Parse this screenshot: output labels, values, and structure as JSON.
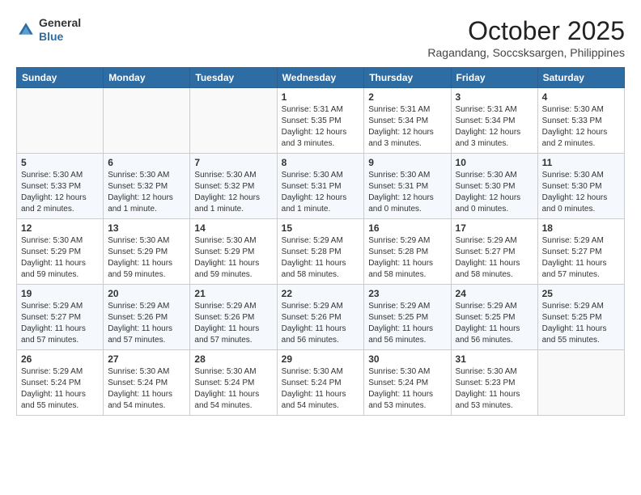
{
  "header": {
    "logo_general": "General",
    "logo_blue": "Blue",
    "month": "October 2025",
    "location": "Ragandang, Soccsksargen, Philippines"
  },
  "days_of_week": [
    "Sunday",
    "Monday",
    "Tuesday",
    "Wednesday",
    "Thursday",
    "Friday",
    "Saturday"
  ],
  "weeks": [
    [
      {
        "day": "",
        "content": ""
      },
      {
        "day": "",
        "content": ""
      },
      {
        "day": "",
        "content": ""
      },
      {
        "day": "1",
        "content": "Sunrise: 5:31 AM\nSunset: 5:35 PM\nDaylight: 12 hours and 3 minutes."
      },
      {
        "day": "2",
        "content": "Sunrise: 5:31 AM\nSunset: 5:34 PM\nDaylight: 12 hours and 3 minutes."
      },
      {
        "day": "3",
        "content": "Sunrise: 5:31 AM\nSunset: 5:34 PM\nDaylight: 12 hours and 3 minutes."
      },
      {
        "day": "4",
        "content": "Sunrise: 5:30 AM\nSunset: 5:33 PM\nDaylight: 12 hours and 2 minutes."
      }
    ],
    [
      {
        "day": "5",
        "content": "Sunrise: 5:30 AM\nSunset: 5:33 PM\nDaylight: 12 hours and 2 minutes."
      },
      {
        "day": "6",
        "content": "Sunrise: 5:30 AM\nSunset: 5:32 PM\nDaylight: 12 hours and 1 minute."
      },
      {
        "day": "7",
        "content": "Sunrise: 5:30 AM\nSunset: 5:32 PM\nDaylight: 12 hours and 1 minute."
      },
      {
        "day": "8",
        "content": "Sunrise: 5:30 AM\nSunset: 5:31 PM\nDaylight: 12 hours and 1 minute."
      },
      {
        "day": "9",
        "content": "Sunrise: 5:30 AM\nSunset: 5:31 PM\nDaylight: 12 hours and 0 minutes."
      },
      {
        "day": "10",
        "content": "Sunrise: 5:30 AM\nSunset: 5:30 PM\nDaylight: 12 hours and 0 minutes."
      },
      {
        "day": "11",
        "content": "Sunrise: 5:30 AM\nSunset: 5:30 PM\nDaylight: 12 hours and 0 minutes."
      }
    ],
    [
      {
        "day": "12",
        "content": "Sunrise: 5:30 AM\nSunset: 5:29 PM\nDaylight: 11 hours and 59 minutes."
      },
      {
        "day": "13",
        "content": "Sunrise: 5:30 AM\nSunset: 5:29 PM\nDaylight: 11 hours and 59 minutes."
      },
      {
        "day": "14",
        "content": "Sunrise: 5:30 AM\nSunset: 5:29 PM\nDaylight: 11 hours and 59 minutes."
      },
      {
        "day": "15",
        "content": "Sunrise: 5:29 AM\nSunset: 5:28 PM\nDaylight: 11 hours and 58 minutes."
      },
      {
        "day": "16",
        "content": "Sunrise: 5:29 AM\nSunset: 5:28 PM\nDaylight: 11 hours and 58 minutes."
      },
      {
        "day": "17",
        "content": "Sunrise: 5:29 AM\nSunset: 5:27 PM\nDaylight: 11 hours and 58 minutes."
      },
      {
        "day": "18",
        "content": "Sunrise: 5:29 AM\nSunset: 5:27 PM\nDaylight: 11 hours and 57 minutes."
      }
    ],
    [
      {
        "day": "19",
        "content": "Sunrise: 5:29 AM\nSunset: 5:27 PM\nDaylight: 11 hours and 57 minutes."
      },
      {
        "day": "20",
        "content": "Sunrise: 5:29 AM\nSunset: 5:26 PM\nDaylight: 11 hours and 57 minutes."
      },
      {
        "day": "21",
        "content": "Sunrise: 5:29 AM\nSunset: 5:26 PM\nDaylight: 11 hours and 57 minutes."
      },
      {
        "day": "22",
        "content": "Sunrise: 5:29 AM\nSunset: 5:26 PM\nDaylight: 11 hours and 56 minutes."
      },
      {
        "day": "23",
        "content": "Sunrise: 5:29 AM\nSunset: 5:25 PM\nDaylight: 11 hours and 56 minutes."
      },
      {
        "day": "24",
        "content": "Sunrise: 5:29 AM\nSunset: 5:25 PM\nDaylight: 11 hours and 56 minutes."
      },
      {
        "day": "25",
        "content": "Sunrise: 5:29 AM\nSunset: 5:25 PM\nDaylight: 11 hours and 55 minutes."
      }
    ],
    [
      {
        "day": "26",
        "content": "Sunrise: 5:29 AM\nSunset: 5:24 PM\nDaylight: 11 hours and 55 minutes."
      },
      {
        "day": "27",
        "content": "Sunrise: 5:30 AM\nSunset: 5:24 PM\nDaylight: 11 hours and 54 minutes."
      },
      {
        "day": "28",
        "content": "Sunrise: 5:30 AM\nSunset: 5:24 PM\nDaylight: 11 hours and 54 minutes."
      },
      {
        "day": "29",
        "content": "Sunrise: 5:30 AM\nSunset: 5:24 PM\nDaylight: 11 hours and 54 minutes."
      },
      {
        "day": "30",
        "content": "Sunrise: 5:30 AM\nSunset: 5:24 PM\nDaylight: 11 hours and 53 minutes."
      },
      {
        "day": "31",
        "content": "Sunrise: 5:30 AM\nSunset: 5:23 PM\nDaylight: 11 hours and 53 minutes."
      },
      {
        "day": "",
        "content": ""
      }
    ]
  ]
}
